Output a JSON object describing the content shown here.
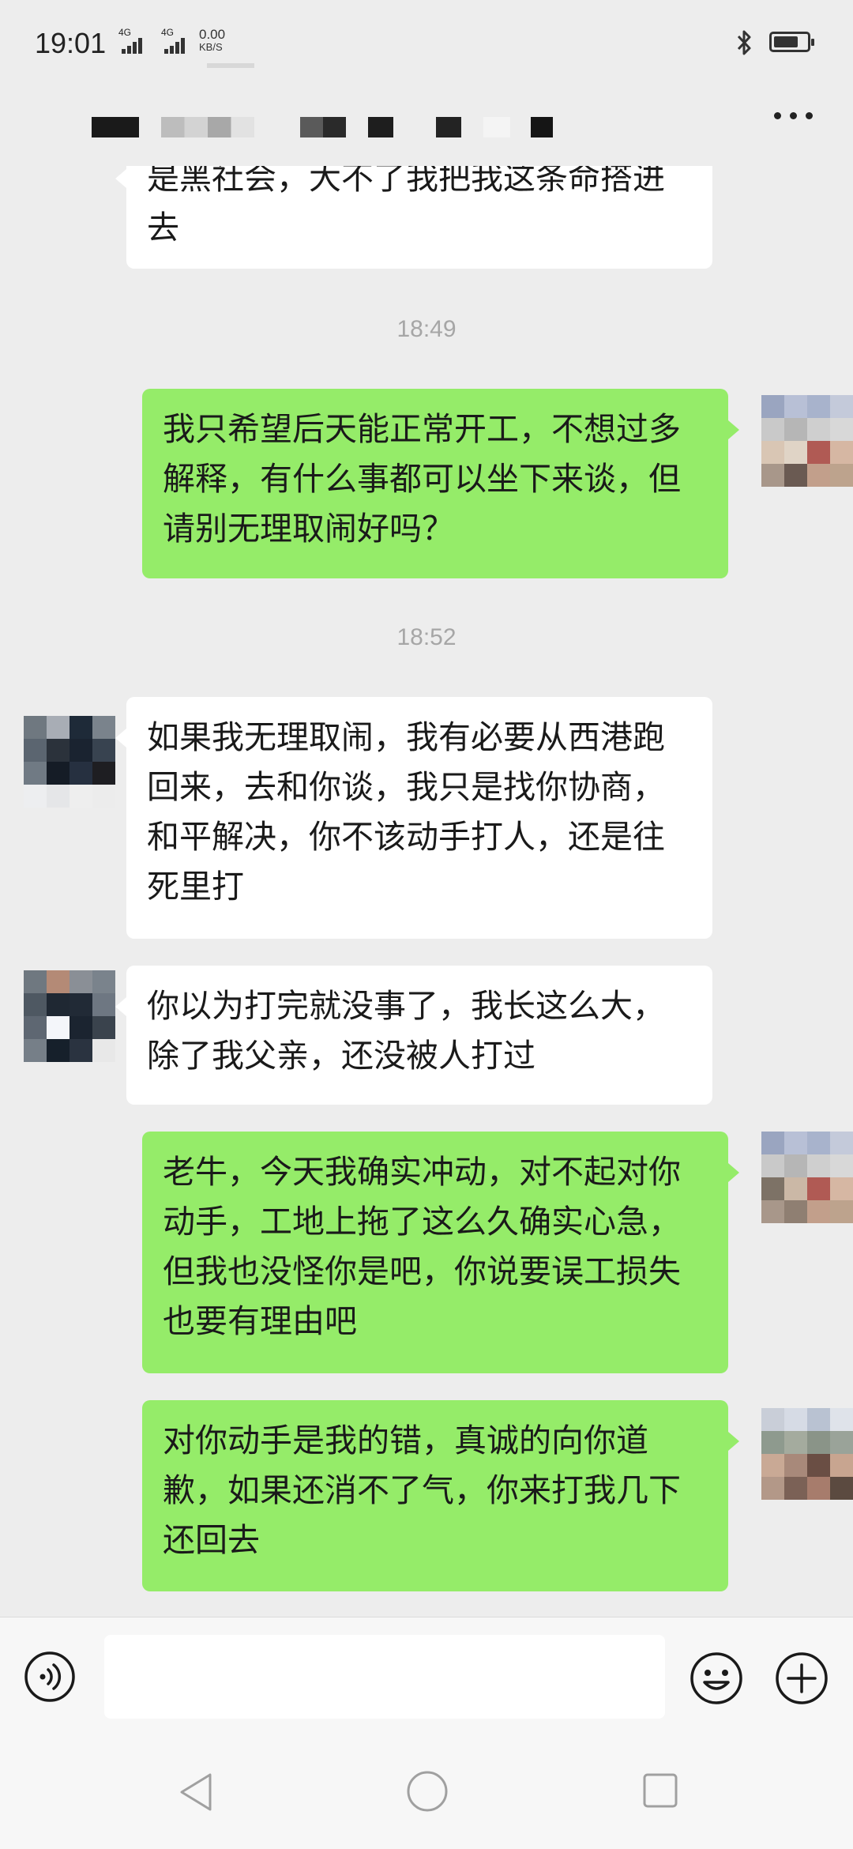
{
  "status_bar": {
    "time": "19:01",
    "network_1": "4G",
    "network_2": "4G",
    "speed_value": "0.00",
    "speed_unit": "KB/S",
    "battery_level": 0.75
  },
  "header": {
    "title_redacted": true
  },
  "messages": [
    {
      "side": "left",
      "text": "是黑社会，大不了我把我这条命搭进去"
    },
    {
      "type": "timestamp",
      "text": "18:49"
    },
    {
      "side": "right",
      "text": "我只希望后天能正常开工，不想过多解释，有什么事都可以坐下来谈，但请别无理取闹好吗？"
    },
    {
      "type": "timestamp",
      "text": "18:52"
    },
    {
      "side": "left",
      "text": "如果我无理取闹，我有必要从西港跑回来，去和你谈，我只是找你协商，和平解决，你不该动手打人，还是往死里打"
    },
    {
      "side": "left",
      "text": "你以为打完就没事了，我长这么大，除了我父亲，还没被人打过"
    },
    {
      "side": "right",
      "text": "老牛，今天我确实冲动，对不起对你动手，工地上拖了这么久确实心急，但我也没怪你是吧，你说要误工损失也要有理由吧"
    },
    {
      "side": "right",
      "text": "对你动手是我的错，真诚的向你道歉，如果还消不了气，你来打我几下还回去"
    }
  ],
  "input": {
    "value": "",
    "placeholder": ""
  },
  "icons": {
    "voice": "voice-icon",
    "emoji": "emoji-icon",
    "plus": "plus-icon",
    "more": "more-icon",
    "back": "nav-back-icon",
    "home": "nav-home-icon",
    "recent": "nav-recent-icon"
  },
  "colors": {
    "background": "#ededed",
    "bubble_self": "#95ec69",
    "bubble_other": "#ffffff",
    "timestamp": "#a6a6a6"
  }
}
